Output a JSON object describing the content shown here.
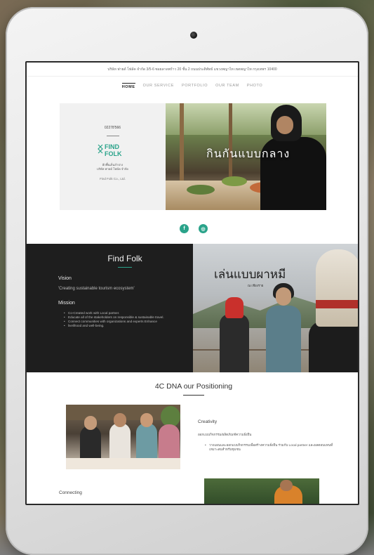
{
  "topbar": {
    "address": "บริษัท ฟายด์ โฟล์ค จำกัด 3/5-6 ซอยลาดพร้าว 20 ชั้น 2 ถนนประดิพัทธ์ แขวงพญาไท เขตพญาไท กรุงเทพฯ 10400"
  },
  "nav": {
    "items": [
      {
        "label": "HOME",
        "active": true
      },
      {
        "label": "OUR SERVICE",
        "active": false
      },
      {
        "label": "PORTFOLIO",
        "active": false
      },
      {
        "label": "OUR TEAM",
        "active": false
      },
      {
        "label": "PHOTO",
        "active": false
      }
    ]
  },
  "hero": {
    "phone": "02278'566",
    "logo_text_line1": "FIND",
    "logo_text_line2": "FOLK",
    "company_th_line1": "ฮักพื้นเถิ่นลำปาง",
    "company_th_line2": "บริษัท ฟายด์ โฟล์ค จำกัด",
    "company_en": "Find Folk Co., Ltd.",
    "overlay_text": "กินกันแบบกลาง"
  },
  "social": {
    "facebook_glyph": "f",
    "instagram_glyph": "◎"
  },
  "about": {
    "title": "Find Folk",
    "vision_heading": "Vision",
    "vision_text": "'Creating sustainable tourism ecosystem'",
    "mission_heading": "Mission",
    "mission_items": [
      "Co-Created work with Local partner.",
      "Educate all of the stakeholders on responsible & sustainable travel.",
      "Connect communities with organizations and experts Enhance",
      "livelihood and well-being."
    ],
    "overlay_title": "เล่นแบบผาหมี",
    "overlay_sub": "ณ เชียงราย"
  },
  "dna": {
    "title": "4C DNA our Positioning"
  },
  "creativity": {
    "title": "Creativity",
    "subtitle": "ออกแบบกิจกรรม/ผลิตภัณฑ์ความยั่งยืน",
    "items": [
      "วางแผนและออกแบบกิจกรรมเพื่อสร้างความยั่งยืน ร่วมกับ Local partner และผลตอบแทนที่เหมาะสมสำหรับชุมชน"
    ]
  },
  "connecting": {
    "title": "Connecting"
  },
  "colors": {
    "accent": "#2aa38a",
    "dark_panel": "#1e1e1e",
    "hero_panel": "#f1f1f1"
  }
}
